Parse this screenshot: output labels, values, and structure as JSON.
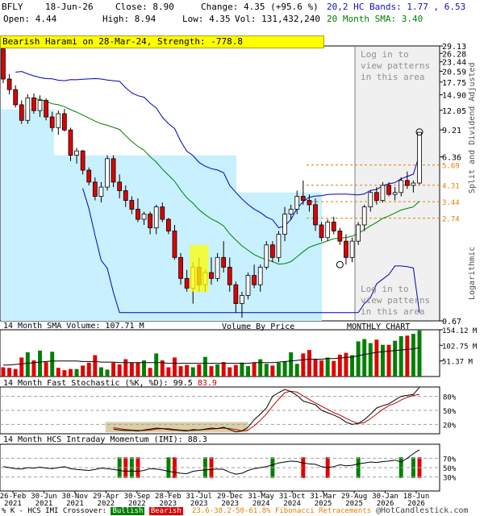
{
  "header": {
    "symbol": "BFLY",
    "date": "18-Jun-26",
    "close": "Close: 8.90",
    "change": "Change: 4.35 (+95.6 %)",
    "open": "Open: 4.44",
    "high": "High: 8.94",
    "low": "Low: 4.35",
    "volume": "Vol: 131,432,240",
    "bands": "20,2 HC Bands: 1.77 , 6.53",
    "sma": "20 Month SMA: 3.40"
  },
  "pattern_label": "Bearish Harami on 28-Mar-24, Strength: -778.8",
  "overlay_top": "Log in to view patterns in this area",
  "overlay_bottom": "Log in to view patterns in this area",
  "side_label_top": "Split and Dividend Adjusted",
  "side_label_bottom": "Logarithmic",
  "panel_labels": {
    "volume": "14 Month SMA Volume: 107.71 M",
    "vbp": "Volume By Price",
    "period": "MONTHLY CHART",
    "stoch": "14 Month Fast Stochastic (%K, %D):",
    "stoch_k": "99.5",
    "stoch_d": "83.9",
    "momentum": "14 Month HCS Intraday Momentum (IMI): 88.3"
  },
  "footer": {
    "legend_prefix": "% K - HCS IMI Crossover:",
    "bullish": "Bullish",
    "bearish": "Bearish",
    "fib": "23.6-38.2-50-61.8% Fibonacci Retracements",
    "brand": "@HotCandlestick.com"
  },
  "colors": {
    "up": "#008000",
    "down": "#e00000",
    "band": "#0000c0",
    "sma": "#008000",
    "vbp": "#c8f0ff",
    "fib": "#e08000"
  },
  "chart_data": [
    {
      "type": "candlestick",
      "scale": "log",
      "ylim": [
        0.67,
        29.13
      ],
      "price_ticks": [
        "29.13",
        "26.28",
        "23.44",
        "20.59",
        "17.75",
        "14.90",
        "12.05",
        "9.21",
        "6.36",
        "0.67"
      ],
      "fib_levels": [
        "5.69",
        "4.31",
        "3.44",
        "2.74"
      ],
      "x_ticks": [
        "26-Feb 2021",
        "30-Jun 2021",
        "30-Nov 2021",
        "29-Apr 2022",
        "30-Sep 2022",
        "28-Feb 2023",
        "31-Jul 2023",
        "29-Dec 2023",
        "31-May 2024",
        "31-Oct 2024",
        "31-Mar 2025",
        "29-Aug 2025",
        "30-Jan 2026",
        "18-Jun 2026"
      ],
      "candles": [
        {
          "o": 28.0,
          "h": 29.13,
          "l": 17.5,
          "c": 18.5
        },
        {
          "o": 18.5,
          "h": 19.8,
          "l": 15.0,
          "c": 16.0
        },
        {
          "o": 16.0,
          "h": 17.0,
          "l": 12.5,
          "c": 13.0
        },
        {
          "o": 13.0,
          "h": 13.8,
          "l": 10.0,
          "c": 10.5
        },
        {
          "o": 10.5,
          "h": 15.0,
          "l": 10.0,
          "c": 14.3
        },
        {
          "o": 14.3,
          "h": 15.2,
          "l": 11.5,
          "c": 12.0
        },
        {
          "o": 12.0,
          "h": 14.8,
          "l": 11.0,
          "c": 13.8
        },
        {
          "o": 13.8,
          "h": 14.2,
          "l": 10.5,
          "c": 11.0
        },
        {
          "o": 11.0,
          "h": 11.8,
          "l": 9.0,
          "c": 9.5
        },
        {
          "o": 9.5,
          "h": 12.0,
          "l": 8.6,
          "c": 11.5
        },
        {
          "o": 11.5,
          "h": 12.3,
          "l": 9.0,
          "c": 9.2
        },
        {
          "o": 9.2,
          "h": 9.5,
          "l": 6.0,
          "c": 6.5
        },
        {
          "o": 6.5,
          "h": 7.2,
          "l": 5.8,
          "c": 6.9
        },
        {
          "o": 6.9,
          "h": 7.0,
          "l": 5.0,
          "c": 5.3
        },
        {
          "o": 5.3,
          "h": 5.5,
          "l": 4.3,
          "c": 4.5
        },
        {
          "o": 4.5,
          "h": 4.8,
          "l": 3.5,
          "c": 3.7
        },
        {
          "o": 3.7,
          "h": 4.5,
          "l": 3.4,
          "c": 4.2
        },
        {
          "o": 4.2,
          "h": 6.5,
          "l": 4.0,
          "c": 6.2
        },
        {
          "o": 6.2,
          "h": 6.5,
          "l": 4.2,
          "c": 4.5
        },
        {
          "o": 4.5,
          "h": 5.0,
          "l": 3.6,
          "c": 4.0
        },
        {
          "o": 4.0,
          "h": 4.3,
          "l": 3.2,
          "c": 3.5
        },
        {
          "o": 3.5,
          "h": 3.7,
          "l": 2.9,
          "c": 3.1
        },
        {
          "o": 3.1,
          "h": 3.6,
          "l": 2.6,
          "c": 2.7
        },
        {
          "o": 2.7,
          "h": 3.0,
          "l": 2.5,
          "c": 2.9
        },
        {
          "o": 2.9,
          "h": 3.0,
          "l": 2.2,
          "c": 2.4
        },
        {
          "o": 2.4,
          "h": 3.3,
          "l": 2.2,
          "c": 3.2
        },
        {
          "o": 3.2,
          "h": 3.4,
          "l": 2.6,
          "c": 2.7
        },
        {
          "o": 2.7,
          "h": 2.75,
          "l": 2.2,
          "c": 2.3
        },
        {
          "o": 2.3,
          "h": 2.5,
          "l": 1.55,
          "c": 1.6
        },
        {
          "o": 1.6,
          "h": 1.7,
          "l": 1.1,
          "c": 1.2
        },
        {
          "o": 1.2,
          "h": 1.35,
          "l": 1.0,
          "c": 1.05
        },
        {
          "o": 1.05,
          "h": 1.5,
          "l": 0.85,
          "c": 1.4
        },
        {
          "o": 1.4,
          "h": 1.6,
          "l": 1.0,
          "c": 1.1
        },
        {
          "o": 1.1,
          "h": 1.35,
          "l": 1.0,
          "c": 1.3
        },
        {
          "o": 1.3,
          "h": 1.6,
          "l": 1.1,
          "c": 1.2
        },
        {
          "o": 1.2,
          "h": 1.7,
          "l": 1.15,
          "c": 1.6
        },
        {
          "o": 1.6,
          "h": 2.0,
          "l": 1.3,
          "c": 1.4
        },
        {
          "o": 1.4,
          "h": 1.6,
          "l": 1.0,
          "c": 1.1
        },
        {
          "o": 1.1,
          "h": 1.15,
          "l": 0.75,
          "c": 0.85
        },
        {
          "o": 0.85,
          "h": 1.0,
          "l": 0.7,
          "c": 0.95
        },
        {
          "o": 0.95,
          "h": 1.3,
          "l": 0.9,
          "c": 1.25
        },
        {
          "o": 1.25,
          "h": 1.45,
          "l": 1.05,
          "c": 1.1
        },
        {
          "o": 1.1,
          "h": 1.45,
          "l": 1.0,
          "c": 1.4
        },
        {
          "o": 1.4,
          "h": 2.0,
          "l": 1.35,
          "c": 1.9
        },
        {
          "o": 1.9,
          "h": 2.0,
          "l": 1.5,
          "c": 1.6
        },
        {
          "o": 1.6,
          "h": 2.3,
          "l": 1.5,
          "c": 2.2
        },
        {
          "o": 2.2,
          "h": 3.2,
          "l": 2.0,
          "c": 2.9
        },
        {
          "o": 2.9,
          "h": 3.3,
          "l": 2.7,
          "c": 3.1
        },
        {
          "o": 3.1,
          "h": 4.0,
          "l": 2.9,
          "c": 3.7
        },
        {
          "o": 3.7,
          "h": 4.6,
          "l": 3.3,
          "c": 3.5
        },
        {
          "o": 3.5,
          "h": 3.8,
          "l": 3.0,
          "c": 3.3
        },
        {
          "o": 3.3,
          "h": 3.6,
          "l": 2.3,
          "c": 2.5
        },
        {
          "o": 2.5,
          "h": 2.6,
          "l": 2.0,
          "c": 2.1
        },
        {
          "o": 2.1,
          "h": 2.7,
          "l": 2.0,
          "c": 2.6
        },
        {
          "o": 2.6,
          "h": 2.8,
          "l": 2.2,
          "c": 2.3
        },
        {
          "o": 2.3,
          "h": 2.4,
          "l": 1.9,
          "c": 2.0
        },
        {
          "o": 2.0,
          "h": 2.2,
          "l": 1.45,
          "c": 1.6
        },
        {
          "o": 1.6,
          "h": 2.1,
          "l": 1.5,
          "c": 2.0
        },
        {
          "o": 2.0,
          "h": 2.6,
          "l": 1.9,
          "c": 2.5
        },
        {
          "o": 2.5,
          "h": 3.3,
          "l": 2.3,
          "c": 3.2
        },
        {
          "o": 3.2,
          "h": 4.0,
          "l": 3.0,
          "c": 3.9
        },
        {
          "o": 3.9,
          "h": 4.2,
          "l": 3.3,
          "c": 3.5
        },
        {
          "o": 3.5,
          "h": 4.5,
          "l": 3.4,
          "c": 4.3
        },
        {
          "o": 4.3,
          "h": 4.5,
          "l": 3.7,
          "c": 3.8
        },
        {
          "o": 3.8,
          "h": 4.2,
          "l": 3.5,
          "c": 3.9
        },
        {
          "o": 3.9,
          "h": 4.8,
          "l": 3.7,
          "c": 4.6
        },
        {
          "o": 4.6,
          "h": 5.2,
          "l": 4.1,
          "c": 4.3
        },
        {
          "o": 4.3,
          "h": 4.6,
          "l": 3.9,
          "c": 4.44
        },
        {
          "o": 4.44,
          "h": 8.94,
          "l": 4.35,
          "c": 8.9
        }
      ],
      "volume_ylim": [
        0,
        154.12
      ],
      "volume_ticks": [
        "154.12 M",
        "102.75 M",
        "51.37 M"
      ],
      "volume": [
        16,
        15,
        13,
        33,
        42,
        28,
        45,
        25,
        43,
        15,
        11,
        13,
        13,
        19,
        24,
        37,
        16,
        12,
        24,
        21,
        30,
        24,
        24,
        28,
        15,
        40,
        28,
        16,
        33,
        18,
        20,
        16,
        21,
        34,
        18,
        21,
        25,
        16,
        20,
        24,
        18,
        24,
        30,
        22,
        19,
        24,
        26,
        42,
        22,
        40,
        46,
        30,
        28,
        33,
        27,
        38,
        41,
        37,
        61,
        65,
        58,
        64,
        55,
        55,
        62,
        70,
        71,
        74,
        80
      ],
      "volume_up": [
        false,
        false,
        false,
        false,
        true,
        false,
        true,
        false,
        true,
        false,
        false,
        false,
        true,
        false,
        false,
        false,
        true,
        true,
        false,
        false,
        false,
        false,
        false,
        true,
        false,
        true,
        false,
        false,
        false,
        false,
        false,
        true,
        false,
        true,
        false,
        true,
        false,
        false,
        false,
        true,
        true,
        false,
        true,
        true,
        false,
        true,
        true,
        true,
        true,
        false,
        false,
        false,
        false,
        true,
        false,
        false,
        false,
        true,
        true,
        true,
        true,
        false,
        true,
        false,
        true,
        true,
        false,
        true,
        true
      ],
      "volume_sma": [
        20,
        20,
        21,
        22,
        23,
        24,
        25,
        26,
        27,
        27,
        27,
        27,
        27,
        26,
        26,
        26,
        25,
        25,
        25,
        24,
        24,
        24,
        24,
        24,
        24,
        24,
        24,
        23,
        23,
        23,
        23,
        23,
        23,
        23,
        23,
        23,
        23,
        23,
        23,
        23,
        23,
        24,
        24,
        24,
        24,
        25,
        26,
        27,
        28,
        29,
        30,
        30,
        30,
        31,
        31,
        32,
        33,
        34,
        36,
        38,
        40,
        42,
        43,
        44,
        45,
        46,
        47,
        48,
        50
      ],
      "stoch_ylim": [
        0,
        100
      ],
      "stoch_ticks": [
        "80%",
        "50%",
        "20%"
      ],
      "stoch_k": [
        5,
        4,
        5,
        6,
        8,
        14,
        10,
        12,
        9,
        18,
        22,
        14,
        10,
        8,
        9,
        12,
        16,
        14,
        10,
        8,
        7,
        7,
        6,
        8,
        10,
        12,
        11,
        9,
        8,
        7,
        6,
        9,
        8,
        10,
        12,
        11,
        14,
        9,
        4,
        6,
        14,
        30,
        42,
        55,
        80,
        88,
        95,
        90,
        82,
        70,
        66,
        62,
        50,
        45,
        40,
        34,
        25,
        20,
        22,
        30,
        42,
        55,
        60,
        64,
        72,
        80,
        82,
        84,
        99.5
      ],
      "stoch_d": [
        7,
        6,
        5,
        5,
        6,
        9,
        11,
        12,
        11,
        13,
        16,
        18,
        15,
        11,
        9,
        10,
        12,
        14,
        13,
        11,
        9,
        8,
        7,
        7,
        8,
        10,
        11,
        11,
        9,
        8,
        7,
        7,
        8,
        9,
        10,
        11,
        12,
        11,
        9,
        6,
        8,
        17,
        29,
        42,
        59,
        74,
        88,
        91,
        89,
        81,
        73,
        66,
        59,
        52,
        45,
        40,
        33,
        27,
        22,
        24,
        32,
        42,
        52,
        60,
        65,
        72,
        78,
        82,
        83.9
      ],
      "momentum_ylim": [
        0,
        100
      ],
      "momentum_ticks": [
        "70%",
        "50%",
        "30%"
      ],
      "momentum": [
        52,
        50,
        48,
        47,
        50,
        49,
        51,
        49,
        48,
        50,
        52,
        48,
        46,
        45,
        44,
        46,
        49,
        48,
        46,
        44,
        42,
        43,
        42,
        44,
        48,
        47,
        45,
        42,
        40,
        38,
        37,
        42,
        44,
        45,
        46,
        47,
        46,
        40,
        36,
        38,
        44,
        48,
        50,
        52,
        56,
        60,
        62,
        64,
        63,
        60,
        58,
        57,
        52,
        50,
        52,
        56,
        54,
        55,
        58,
        60,
        62,
        61,
        63,
        64,
        66,
        62,
        70,
        80,
        88.3
      ],
      "crossover_bars": [
        {
          "i": 19,
          "dir": "bullish"
        },
        {
          "i": 20,
          "dir": "bearish"
        },
        {
          "i": 21,
          "dir": "bullish"
        },
        {
          "i": 22,
          "dir": "bearish"
        },
        {
          "i": 27,
          "dir": "bullish"
        },
        {
          "i": 28,
          "dir": "bearish"
        },
        {
          "i": 33,
          "dir": "bullish"
        },
        {
          "i": 34,
          "dir": "bearish"
        },
        {
          "i": 44,
          "dir": "bullish"
        },
        {
          "i": 49,
          "dir": "bearish"
        },
        {
          "i": 53,
          "dir": "bearish"
        },
        {
          "i": 58,
          "dir": "bullish"
        },
        {
          "i": 65,
          "dir": "bullish"
        },
        {
          "i": 67,
          "dir": "bullish"
        },
        {
          "i": 68,
          "dir": "bearish"
        }
      ]
    }
  ]
}
